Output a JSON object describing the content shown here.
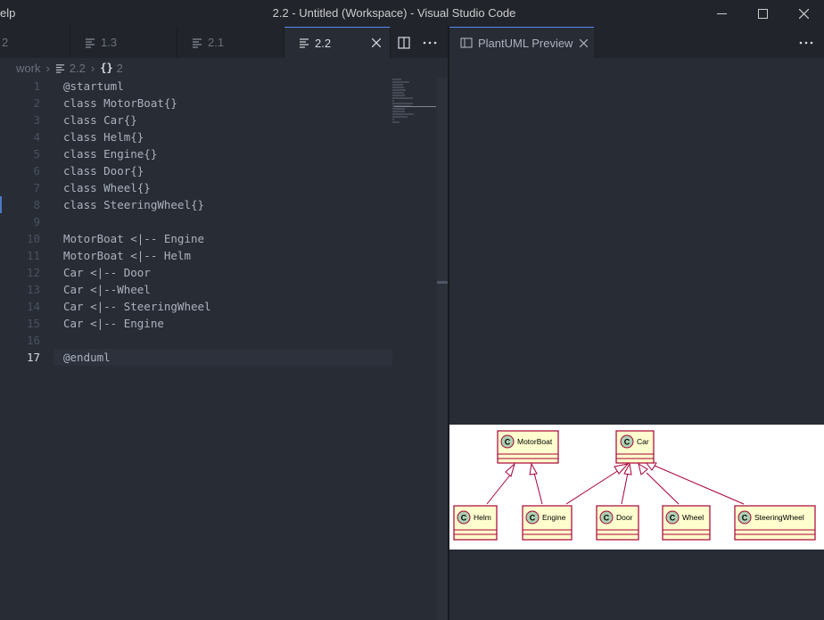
{
  "window": {
    "menu_partial": "elp",
    "title": "2.2 - Untitled (Workspace) - Visual Studio Code"
  },
  "tabs": [
    {
      "label": "2"
    },
    {
      "label": "1.3"
    },
    {
      "label": "2.1"
    },
    {
      "label": "2.2",
      "active": true
    }
  ],
  "preview_tab": {
    "label": "PlantUML Preview"
  },
  "breadcrumb": {
    "folder": "work",
    "file": "2.2",
    "symbol": "2"
  },
  "editor": {
    "current_line": 17,
    "lines": [
      {
        "n": "1",
        "text": "@startuml"
      },
      {
        "n": "2",
        "text": "class MotorBoat{}"
      },
      {
        "n": "3",
        "text": "class Car{}"
      },
      {
        "n": "4",
        "text": "class Helm{}"
      },
      {
        "n": "5",
        "text": "class Engine{}"
      },
      {
        "n": "6",
        "text": "class Door{}"
      },
      {
        "n": "7",
        "text": "class Wheel{}"
      },
      {
        "n": "8",
        "text": "class SteeringWheel{}"
      },
      {
        "n": "9",
        "text": ""
      },
      {
        "n": "10",
        "text": "MotorBoat <|-- Engine"
      },
      {
        "n": "11",
        "text": "MotorBoat <|-- Helm"
      },
      {
        "n": "12",
        "text": "Car <|-- Door"
      },
      {
        "n": "13",
        "text": "Car <|--Wheel"
      },
      {
        "n": "14",
        "text": "Car <|-- SteeringWheel"
      },
      {
        "n": "15",
        "text": "Car <|-- Engine"
      },
      {
        "n": "16",
        "text": ""
      },
      {
        "n": "17",
        "text": "@enduml"
      }
    ]
  },
  "diagram": {
    "classes": {
      "motorboat": "MotorBoat",
      "car": "Car",
      "helm": "Helm",
      "engine": "Engine",
      "door": "Door",
      "wheel": "Wheel",
      "steeringwheel": "SteeringWheel"
    },
    "class_marker": "C"
  },
  "colors": {
    "accent": "#568af2",
    "uml_class_fill": "#fefece",
    "uml_border": "#a80036",
    "uml_marker_fill": "#add1b2"
  },
  "icons": {
    "file": "lines-file-icon",
    "split": "split-editor-icon",
    "more": "more-actions-icon",
    "preview": "preview-icon",
    "close": "close-icon"
  }
}
